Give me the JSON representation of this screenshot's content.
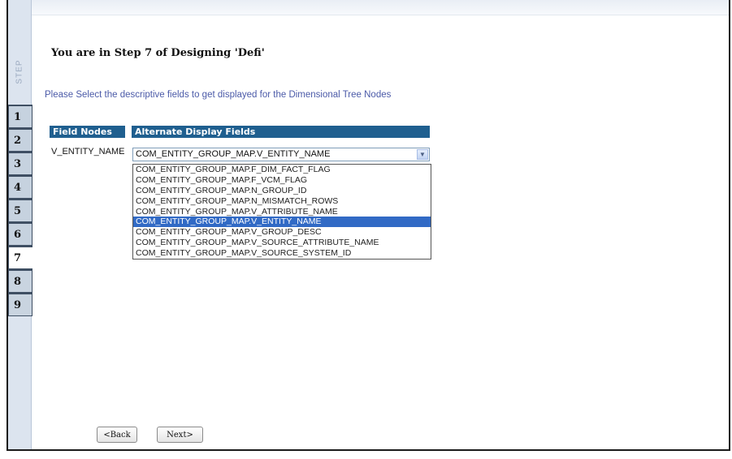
{
  "wizard": {
    "step_label": "STEP",
    "steps": [
      "1",
      "2",
      "3",
      "4",
      "5",
      "6",
      "7",
      "8",
      "9"
    ],
    "active_step": "7",
    "title": "You are in Step 7 of Designing 'Defi'",
    "instructions": "Please Select the descriptive fields to get displayed for the Dimensional Tree Nodes"
  },
  "table": {
    "header_field_nodes": "Field Nodes",
    "header_alternate": "Alternate Display Fields",
    "row": {
      "field_node": "V_ENTITY_NAME",
      "selected_value": "COM_ENTITY_GROUP_MAP.V_ENTITY_NAME"
    }
  },
  "dropdown_options": [
    "COM_ENTITY_GROUP_MAP.F_DIM_FACT_FLAG",
    "COM_ENTITY_GROUP_MAP.F_VCM_FLAG",
    "COM_ENTITY_GROUP_MAP.N_GROUP_ID",
    "COM_ENTITY_GROUP_MAP.N_MISMATCH_ROWS",
    "COM_ENTITY_GROUP_MAP.V_ATTRIBUTE_NAME",
    "COM_ENTITY_GROUP_MAP.V_ENTITY_NAME",
    "COM_ENTITY_GROUP_MAP.V_GROUP_DESC",
    "COM_ENTITY_GROUP_MAP.V_SOURCE_ATTRIBUTE_NAME",
    "COM_ENTITY_GROUP_MAP.V_SOURCE_SYSTEM_ID"
  ],
  "highlighted_option": "COM_ENTITY_GROUP_MAP.V_ENTITY_NAME",
  "buttons": {
    "back": "<Back",
    "next": "Next>"
  },
  "colors": {
    "header_bg": "#1f5f8f",
    "selection_bg": "#316ac5",
    "instruction_text": "#4b5aa8",
    "sidebar_bg": "#dce4ef"
  }
}
